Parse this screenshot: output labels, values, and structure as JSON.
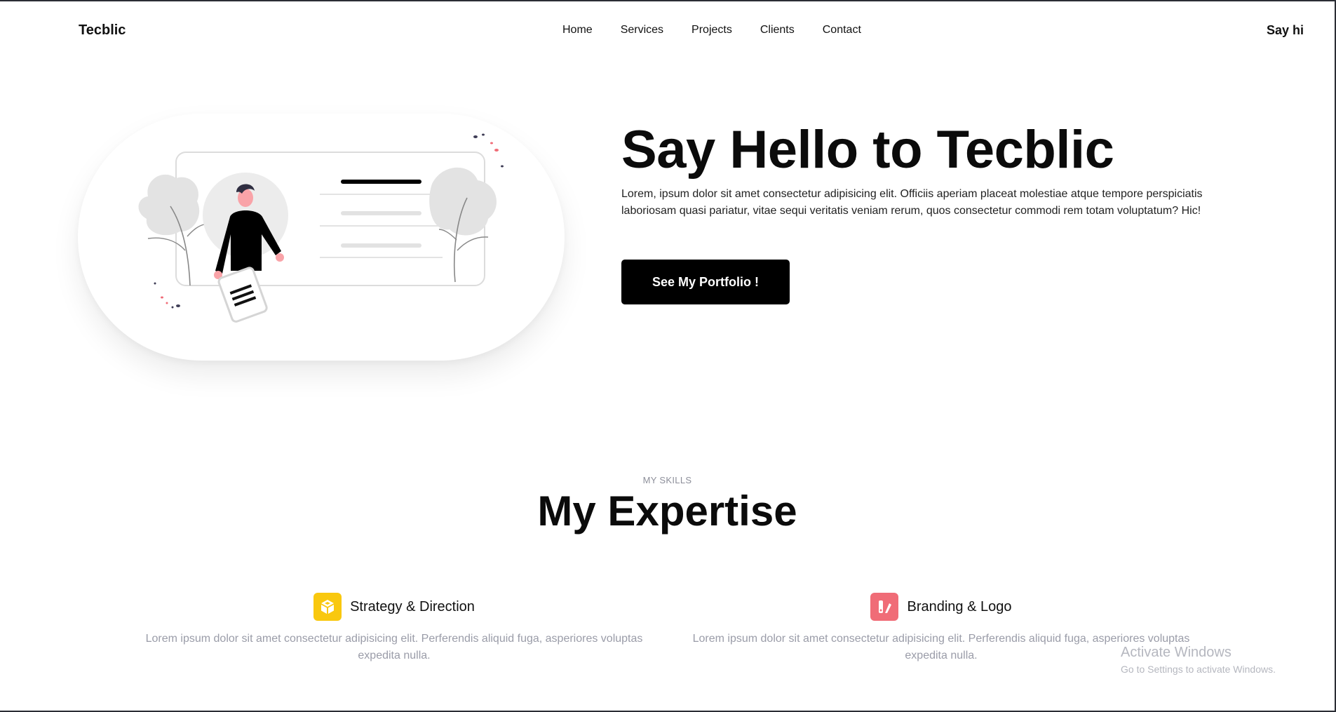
{
  "nav": {
    "brand": "Tecblic",
    "items": [
      "Home",
      "Services",
      "Projects",
      "Clients",
      "Contact"
    ],
    "cta": "Say hi"
  },
  "hero": {
    "title": "Say Hello to Tecblic",
    "text": "Lorem, ipsum dolor sit amet consectetur adipisicing elit. Officiis aperiam placeat molestiae atque tempore perspiciatis laboriosam quasi pariatur, vitae sequi veritatis veniam rerum, quos consectetur commodi rem totam voluptatum? Hic!",
    "button": "See My Portfolio !"
  },
  "skills": {
    "eyebrow": "MY SKILLS",
    "title": "My Expertise",
    "items": [
      {
        "icon": "box-icon",
        "color": "#f9c80e",
        "name": "Strategy & Direction",
        "desc": "Lorem ipsum dolor sit amet consectetur adipisicing elit. Perferendis aliquid fuga, asperiores voluptas expedita nulla."
      },
      {
        "icon": "design-tools-icon",
        "color": "#f06c77",
        "name": "Branding & Logo",
        "desc": "Lorem ipsum dolor sit amet consectetur adipisicing elit. Perferendis aliquid fuga, asperiores voluptas expedita nulla."
      }
    ]
  },
  "watermark": {
    "line1": "Activate Windows",
    "line2": "Go to Settings to activate Windows."
  }
}
